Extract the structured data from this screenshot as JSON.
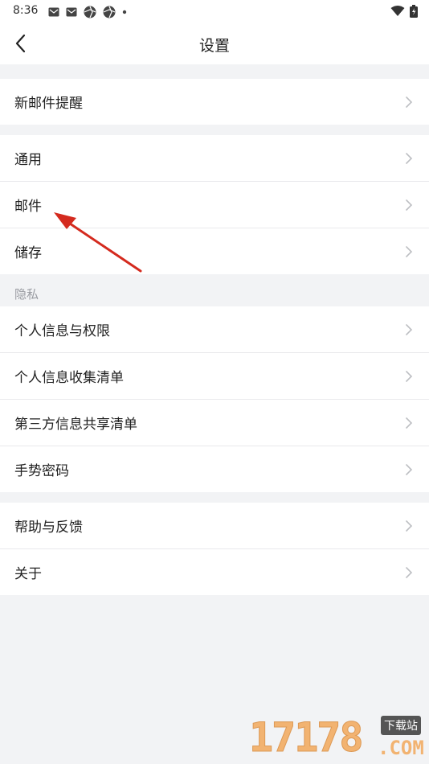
{
  "status_bar": {
    "time": "8:36",
    "left_icons": [
      "mail-icon",
      "mail-icon",
      "aperture-icon",
      "aperture-icon",
      "dot-icon"
    ],
    "right_icons": [
      "wifi-icon",
      "battery-icon"
    ]
  },
  "header": {
    "back_icon": "chevron-left-icon",
    "title": "设置"
  },
  "groups": {
    "notify": {
      "items": [
        "新邮件提醒"
      ]
    },
    "general": {
      "items": [
        "通用",
        "邮件",
        "储存"
      ]
    },
    "privacy": {
      "label": "隐私",
      "items": [
        "个人信息与权限",
        "个人信息收集清单",
        "第三方信息共享清单",
        "手势密码"
      ]
    },
    "about": {
      "items": [
        "帮助与反馈",
        "关于"
      ]
    }
  },
  "watermark": {
    "digits": "17178",
    "badge": "下载站",
    "suffix": ".COM"
  },
  "colors": {
    "background": "#f2f3f5",
    "row_bg": "#ffffff",
    "annotation_arrow": "#d42a1e",
    "watermark": "#f3a85a"
  }
}
